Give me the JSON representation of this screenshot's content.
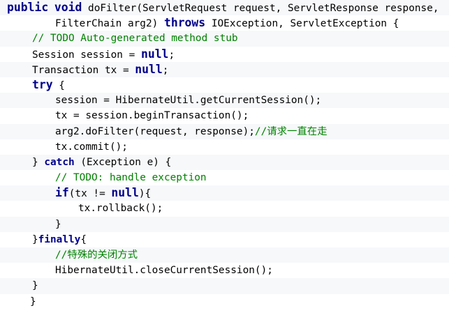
{
  "code": {
    "l1": {
      "kw1": "public",
      "kw2": "void",
      "text": " doFilter(ServletRequest request, ServletResponse response,"
    },
    "l2": {
      "text1": "FilterChain arg2) ",
      "kw": "throws",
      "text2": " IOException, ServletException {"
    },
    "l3": {
      "comment": "// TODO Auto-generated method stub"
    },
    "l4": {
      "text": "Session session = ",
      "kw": "null",
      "tail": ";"
    },
    "l5": {
      "text": "Transaction tx = ",
      "kw": "null",
      "tail": ";"
    },
    "l6": {
      "kw": "try",
      "tail": " {"
    },
    "l7": {
      "text": "session = HibernateUtil.getCurrentSession();"
    },
    "l8": {
      "text": "tx = session.beginTransaction();"
    },
    "l9": {
      "text": "arg2.doFilter(request, response);",
      "comment": "//请求一直在走"
    },
    "l10": {
      "text": "tx.commit();"
    },
    "l11": {
      "head": "} ",
      "kw": "catch",
      "tail": " (Exception e) {"
    },
    "l12": {
      "comment": "// TODO: handle exception"
    },
    "l13": {
      "kw1": "if",
      "mid": "(tx != ",
      "kw2": "null",
      "tail": "){"
    },
    "l14": {
      "text": "tx.rollback();"
    },
    "l15": {
      "text": "}"
    },
    "l16": {
      "head": "}",
      "kw": "finally",
      "tail": "{"
    },
    "l17": {
      "comment": "//特殊的关闭方式"
    },
    "l18": {
      "text": "HibernateUtil.closeCurrentSession();"
    },
    "l19": {
      "text": "}"
    },
    "l20": {
      "text": "}"
    }
  }
}
